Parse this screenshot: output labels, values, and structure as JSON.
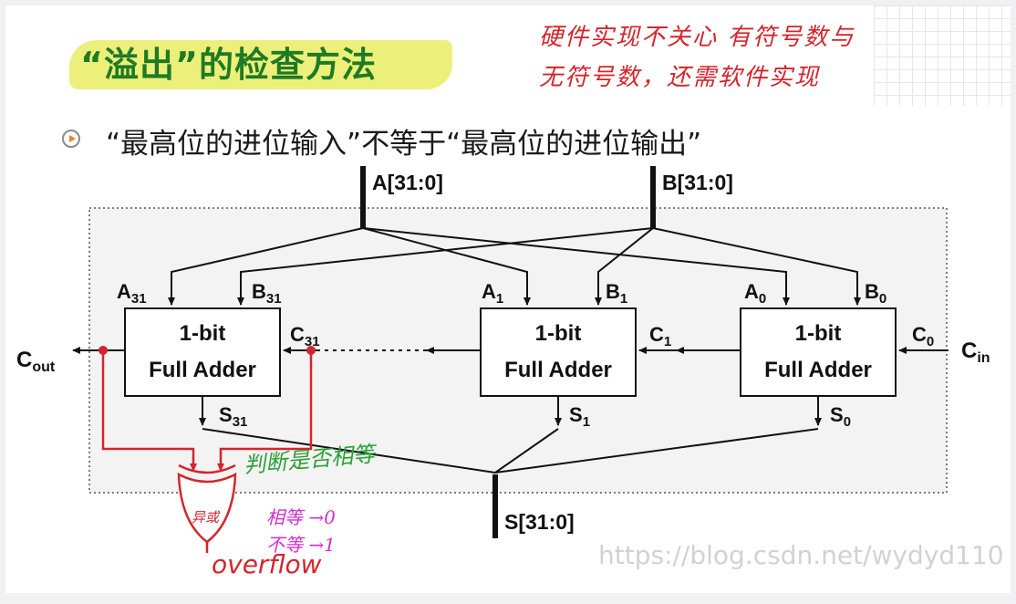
{
  "slide": {
    "title": "“溢出”的检查方法",
    "handwritten_note_line1": "硬件实现不关心 有符号数与",
    "handwritten_note_line2": "无符号数，还需软件实现",
    "bullet": "“最高位的进位输入”不等于“最高位的进位输出”",
    "watermark": "https://blog.csdn.net/wydyd110"
  },
  "diagram": {
    "bus_a": "A[31:0]",
    "bus_b": "B[31:0]",
    "bus_s": "S[31:0]",
    "adders": [
      {
        "line1": "1-bit",
        "line2": "Full Adder",
        "a": "A",
        "a_sub": "31",
        "b": "B",
        "b_sub": "31",
        "cin": "C",
        "cin_sub": "31",
        "s": "S",
        "s_sub": "31"
      },
      {
        "line1": "1-bit",
        "line2": "Full Adder",
        "a": "A",
        "a_sub": "1",
        "b": "B",
        "b_sub": "1",
        "cin": "C",
        "cin_sub": "1",
        "s": "S",
        "s_sub": "1"
      },
      {
        "line1": "1-bit",
        "line2": "Full Adder",
        "a": "A",
        "a_sub": "0",
        "b": "B",
        "b_sub": "0",
        "cin": "C",
        "cin_sub": "0",
        "s": "S",
        "s_sub": "0"
      }
    ],
    "cout": "C",
    "cout_sub": "out",
    "cin": "C",
    "cin_sub": "in",
    "gate_label": "异或",
    "overflow": "overflow",
    "note_compare": "判断是否相等",
    "note_equal": "相等 →0",
    "note_unequal": "不等 →1",
    "colors": {
      "line": "#111111",
      "overflow_path": "#d4252c",
      "note_green": "#2ca033",
      "note_magenta": "#d22fcf"
    }
  }
}
